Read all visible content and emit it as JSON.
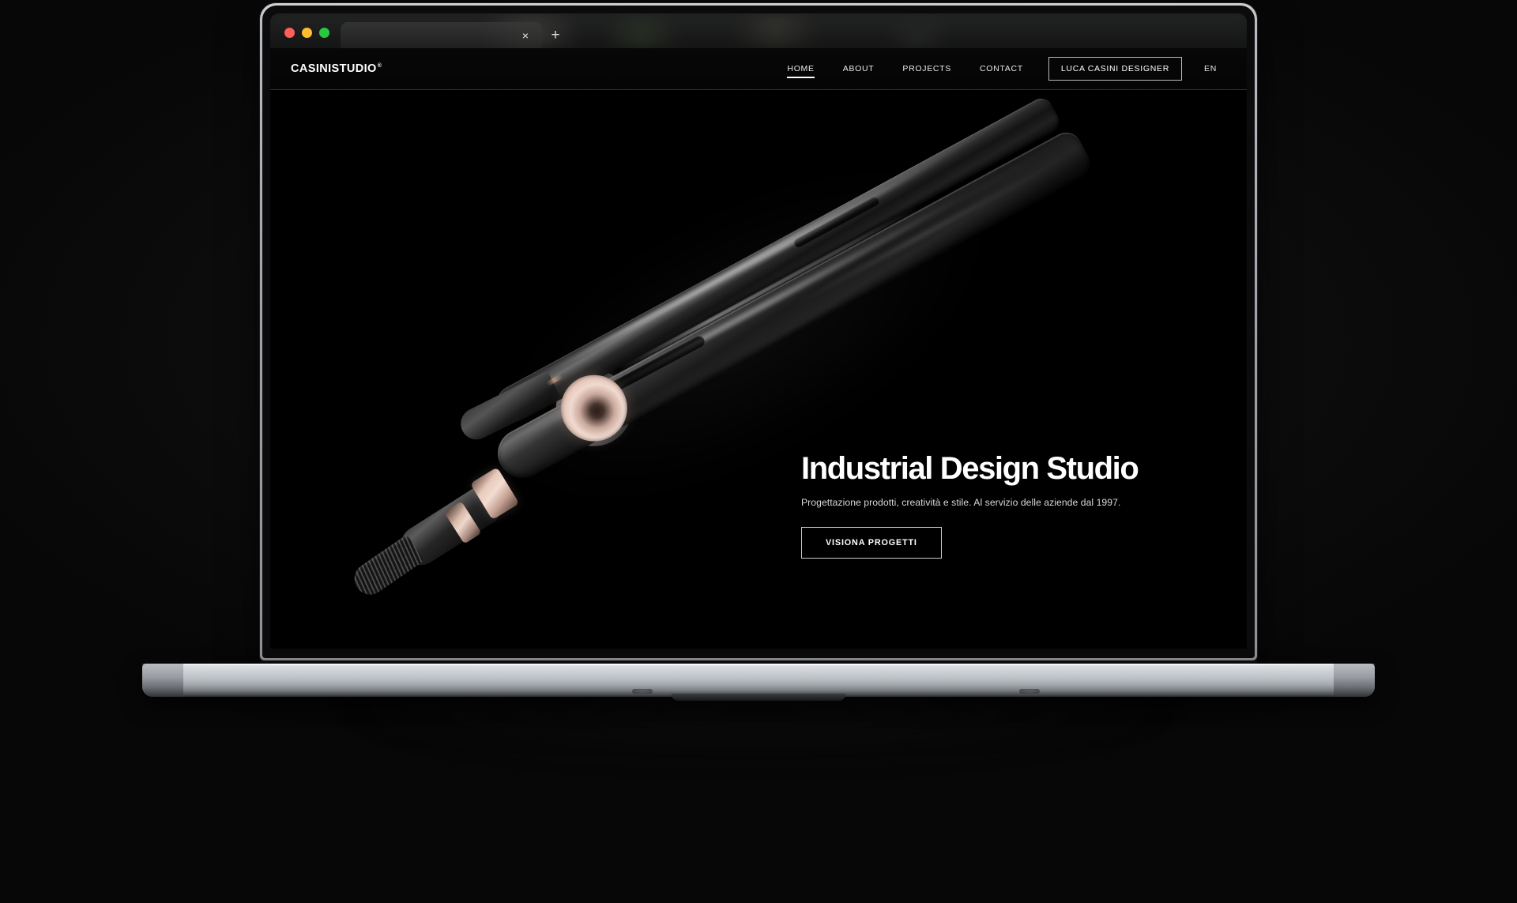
{
  "browser": {
    "traffic_lights": [
      "close",
      "minimize",
      "maximize"
    ],
    "tab": {
      "title": "",
      "close_label": "×"
    },
    "new_tab_label": "+"
  },
  "site": {
    "nav": {
      "logo": "CASINISTUDIO",
      "logo_mark": "®",
      "links": [
        {
          "label": "HOME",
          "active": true
        },
        {
          "label": "ABOUT",
          "active": false
        },
        {
          "label": "PROJECTS",
          "active": false
        },
        {
          "label": "CONTACT",
          "active": false
        }
      ],
      "cta_label": "LUCA CASINI DESIGNER",
      "language": "EN"
    },
    "hero": {
      "headline": "Industrial Design Studio",
      "subhead": "Progettazione prodotti, creatività e stile. Al servizio delle aziende dal 1997.",
      "button_label": "VISIONA PROGETTI"
    },
    "product_image_alt": "black hair straightener with rose gold dial"
  },
  "colors": {
    "page_background": "#0a0a0a",
    "site_background": "#000000",
    "text_primary": "#ffffff",
    "text_secondary": "#d8d8d8",
    "accent_rose_gold": "#f0d9cf",
    "traffic_red": "#ff5f57",
    "traffic_yellow": "#febc2e",
    "traffic_green": "#28c840",
    "device_silver": "#d2d6da"
  }
}
